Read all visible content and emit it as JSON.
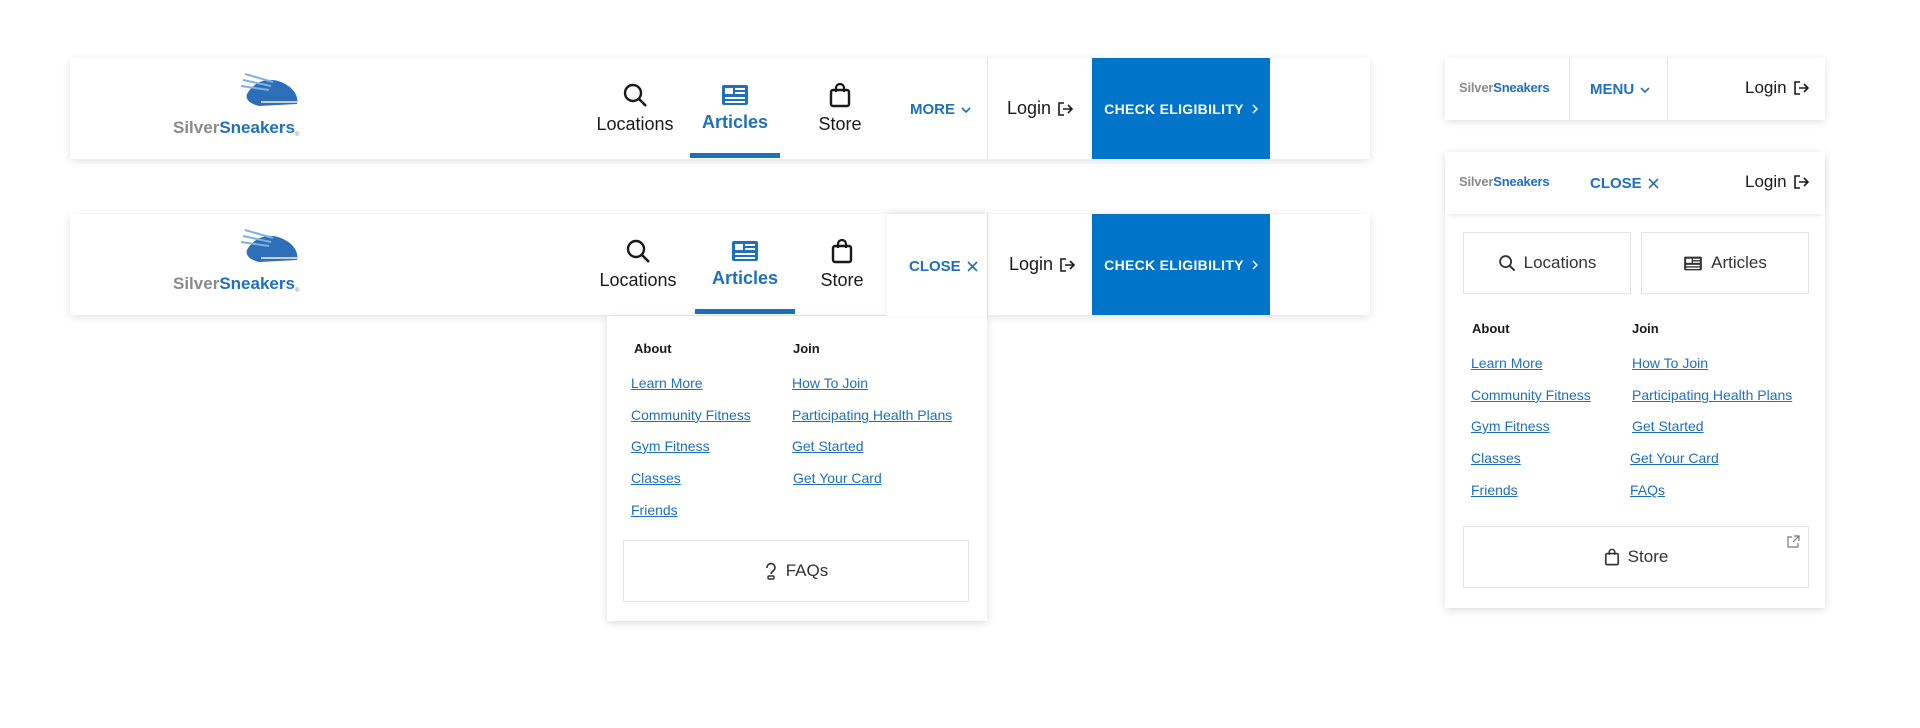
{
  "brand": {
    "silver": "Silver",
    "sneakers": "Sneakers",
    "reg": "®"
  },
  "nav": {
    "locations": "Locations",
    "articles": "Articles",
    "store": "Store",
    "more": "MORE",
    "close": "CLOSE",
    "menu": "MENU",
    "login": "Login",
    "cta": "CHECK ELIGIBILITY"
  },
  "dropdown": {
    "about_title": "About",
    "join_title": "Join",
    "about": [
      "Learn More",
      "Community Fitness",
      "Gym Fitness",
      "Classes",
      "Friends"
    ],
    "join": [
      "How To Join",
      "Participating Health Plans",
      "Get Started",
      "Get Your Card"
    ],
    "faqs": "FAQs"
  },
  "mobile": {
    "about": [
      "Learn More",
      "Community Fitness",
      "Gym Fitness",
      "Classes",
      "Friends"
    ],
    "join": [
      "How To Join",
      "Participating Health Plans",
      "Get Started",
      "Get Your Card",
      "FAQs"
    ],
    "store": "Store"
  },
  "colors": {
    "accent": "#1f6fbf",
    "cta": "#0074c9"
  },
  "icons": [
    "search-icon",
    "newspaper-icon",
    "shopping-bag-icon",
    "chevron-down-icon",
    "close-icon",
    "login-icon",
    "chevron-right-icon",
    "question-bulb-icon",
    "external-link-icon"
  ]
}
